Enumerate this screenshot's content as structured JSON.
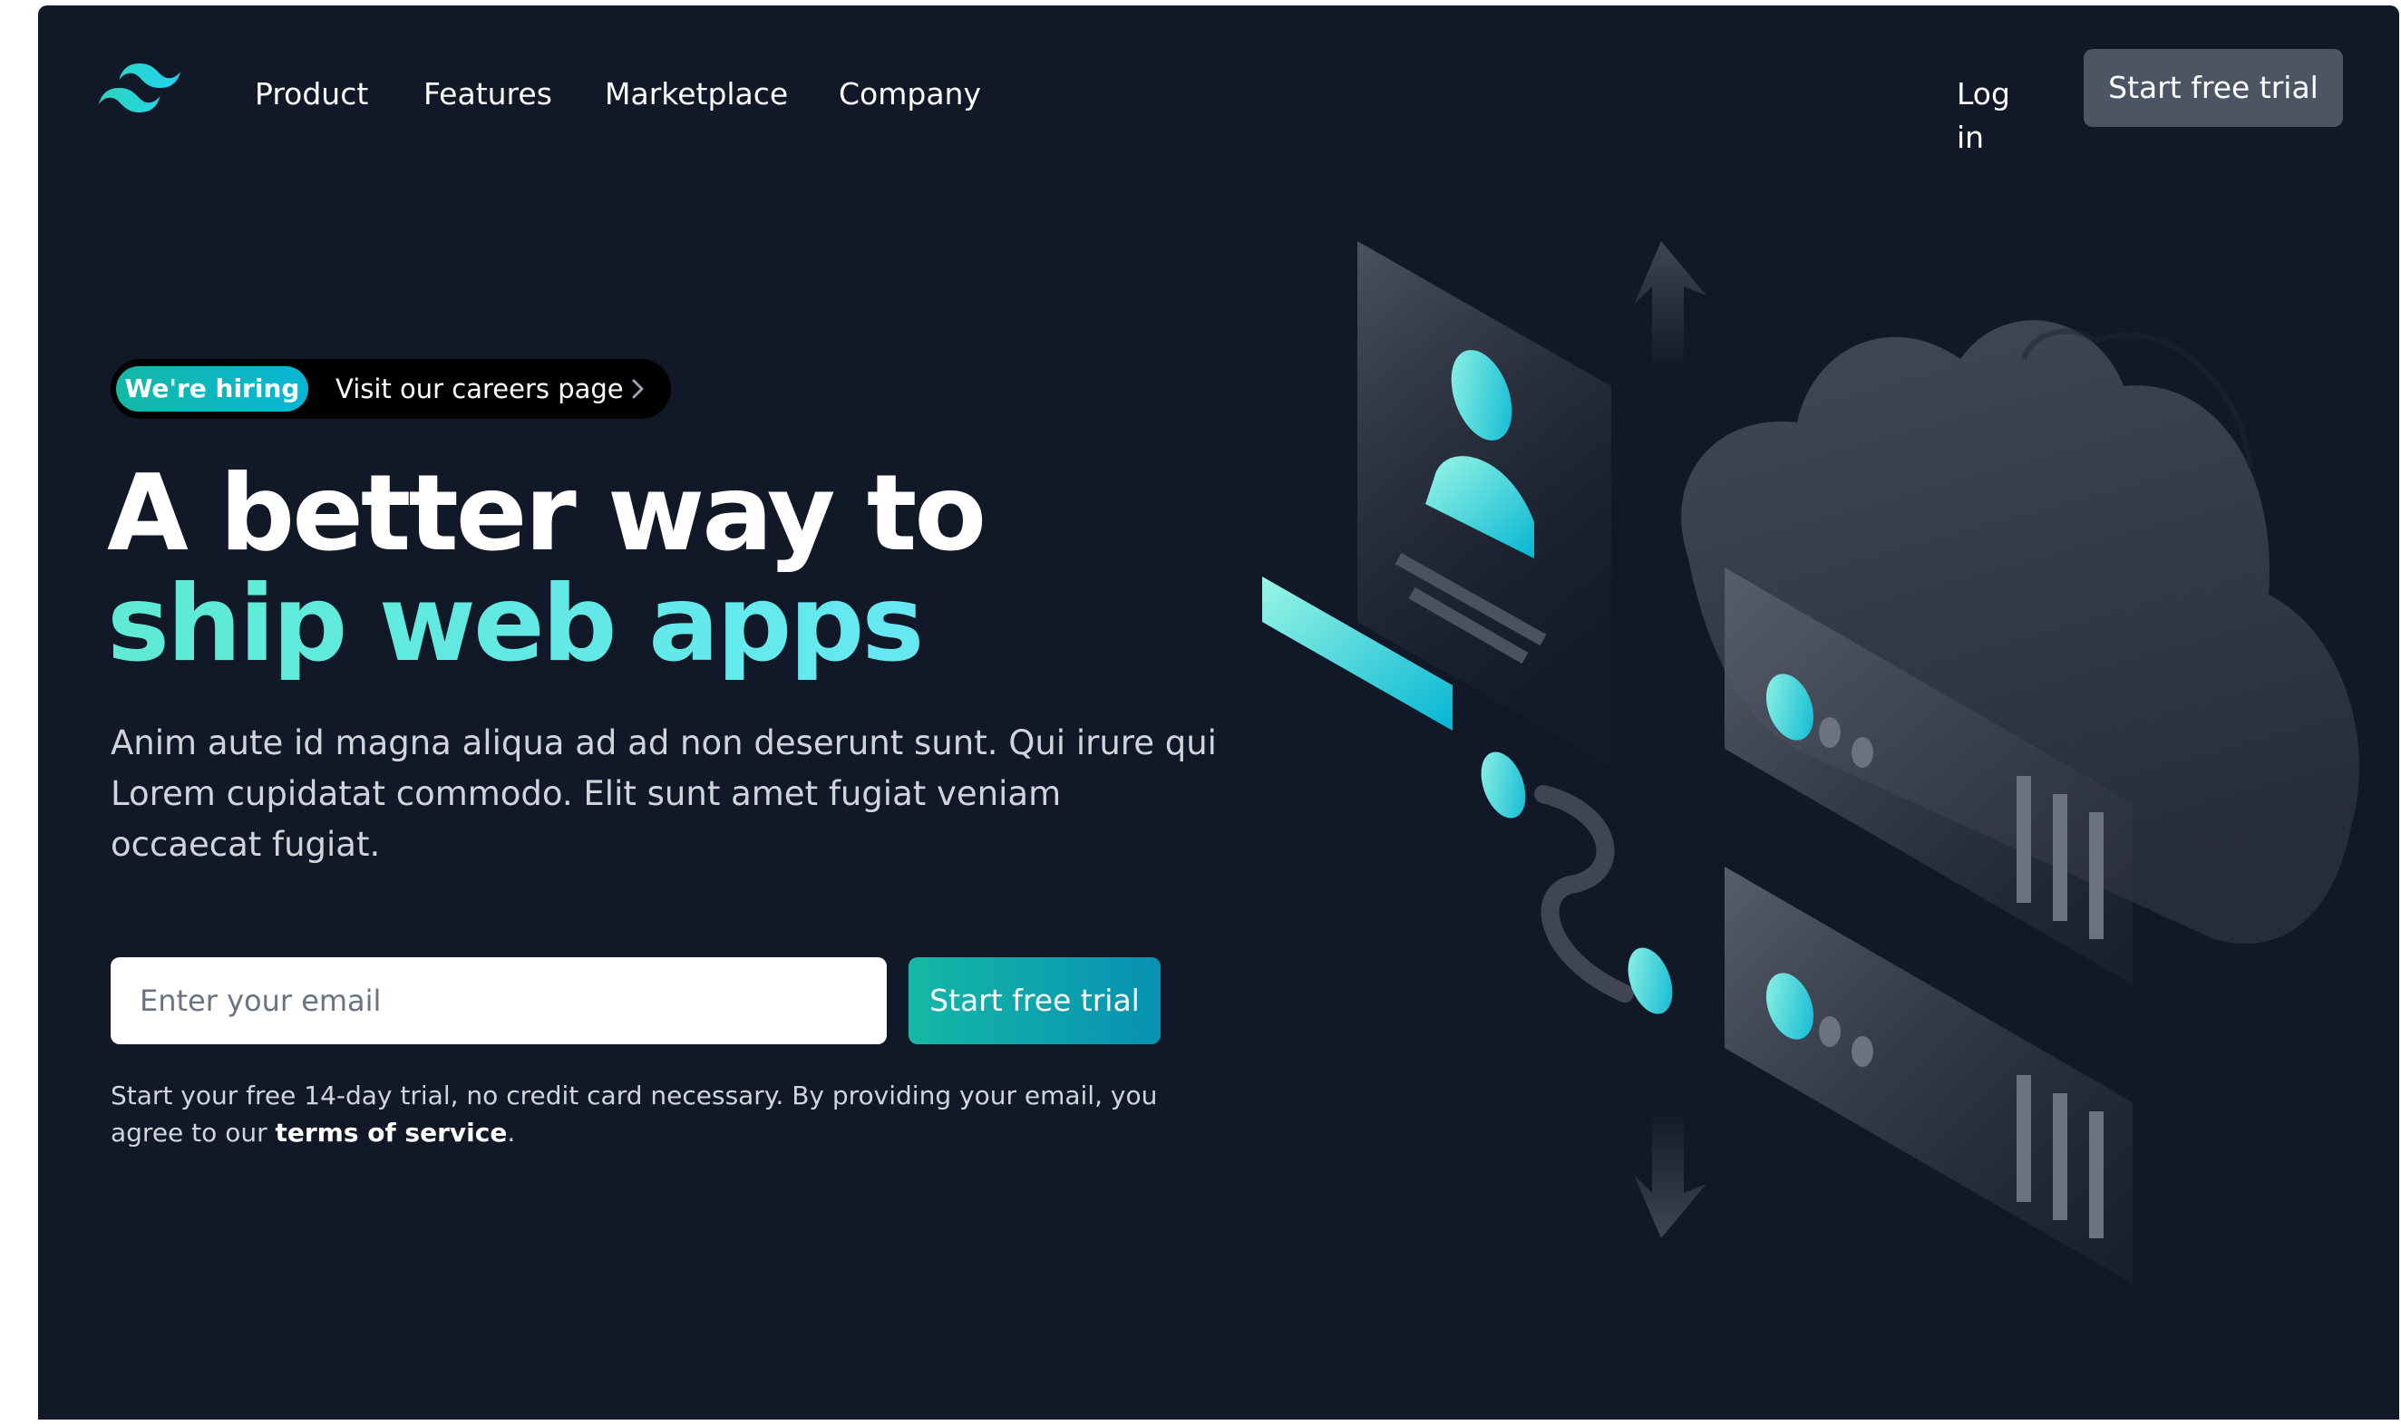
{
  "nav": {
    "links": [
      "Product",
      "Features",
      "Marketplace",
      "Company"
    ],
    "login": "Log in",
    "cta": "Start free trial"
  },
  "hero": {
    "badge": "We're hiring",
    "badge_link": "Visit our careers page",
    "title_line1": "A better way to",
    "title_line2": "ship web apps",
    "lead": "Anim aute id magna aliqua ad ad non deserunt sunt. Qui irure qui Lorem cupidatat commodo. Elit sunt amet fugiat veniam occaecat fugiat.",
    "email_placeholder": "Enter your email",
    "cta": "Start free trial",
    "fine_print": "Start your free 14-day trial, no credit card necessary. By providing your email, you agree to our ",
    "terms_link": "terms of service",
    "fine_print_end": "."
  },
  "icons": {
    "logo": "tailwind-wave-logo",
    "pill_chevron": "chevron-right-icon",
    "illustration": "cloud-servers-illustration"
  },
  "colors": {
    "background": "#111827",
    "accent_teal": "#14b8a6",
    "accent_cyan": "#06b6d4",
    "gradient_text_start": "#5eead4",
    "gradient_text_end": "#67e8f9",
    "nav_button": "#4b5563"
  }
}
